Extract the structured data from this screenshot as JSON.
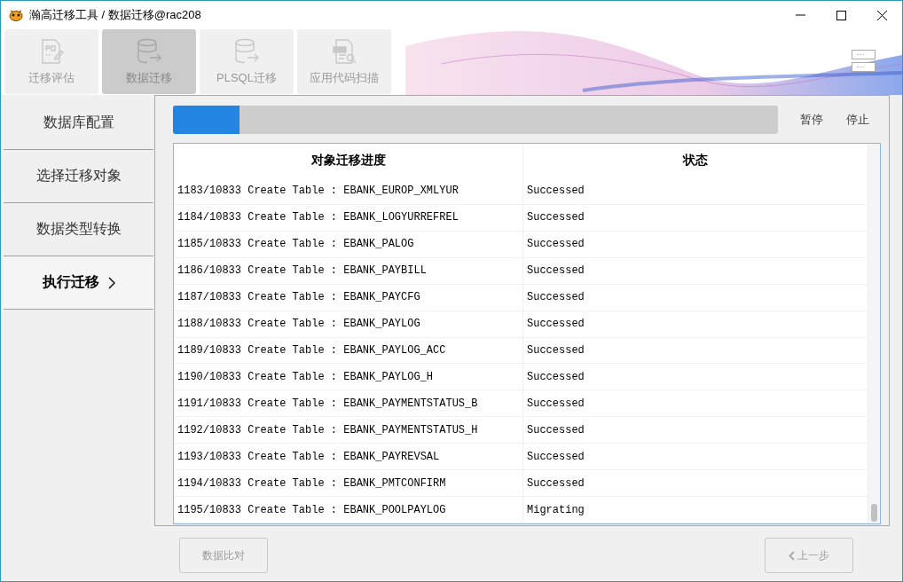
{
  "window": {
    "title": "瀚高迁移工具 / 数据迁移@rac208"
  },
  "tabs": [
    {
      "label": "迁移评估",
      "kind": "assess",
      "selected": false
    },
    {
      "label": "数据迁移",
      "kind": "data",
      "selected": true
    },
    {
      "label": "PLSQL迁移",
      "kind": "plsql",
      "selected": false
    },
    {
      "label": "应用代码扫描",
      "kind": "scan",
      "selected": false
    }
  ],
  "sidebar": {
    "items": [
      {
        "label": "数据库配置",
        "selected": false
      },
      {
        "label": "选择迁移对象",
        "selected": false
      },
      {
        "label": "数据类型转换",
        "selected": false
      },
      {
        "label": "执行迁移",
        "selected": true
      }
    ]
  },
  "progress": {
    "level": 0.11,
    "buttons": [
      "暂停",
      "停止"
    ]
  },
  "table": {
    "columns": [
      "对象迁移进度",
      "状态"
    ],
    "rows": [
      [
        "1183/10833 Create Table : EBANK_EUROP_XMLYUR",
        "Successed"
      ],
      [
        "1184/10833 Create Table : EBANK_LOGYURREFREL",
        "Successed"
      ],
      [
        "1185/10833 Create Table : EBANK_PALOG",
        "Successed"
      ],
      [
        "1186/10833 Create Table : EBANK_PAYBILL",
        "Successed"
      ],
      [
        "1187/10833 Create Table : EBANK_PAYCFG",
        "Successed"
      ],
      [
        "1188/10833 Create Table : EBANK_PAYLOG",
        "Successed"
      ],
      [
        "1189/10833 Create Table : EBANK_PAYLOG_ACC",
        "Successed"
      ],
      [
        "1190/10833 Create Table : EBANK_PAYLOG_H",
        "Successed"
      ],
      [
        "1191/10833 Create Table : EBANK_PAYMENTSTATUS_B",
        "Successed"
      ],
      [
        "1192/10833 Create Table : EBANK_PAYMENTSTATUS_H",
        "Successed"
      ],
      [
        "1193/10833 Create Table : EBANK_PAYREVSAL",
        "Successed"
      ],
      [
        "1194/10833 Create Table : EBANK_PMTCONFIRM",
        "Successed"
      ],
      [
        "1195/10833 Create Table : EBANK_POOLPAYLOG",
        "Migrating"
      ]
    ]
  },
  "footer": {
    "buttons": [
      {
        "label": "数据比对",
        "kind": "plain",
        "disabled": true
      },
      {
        "label": "上一步",
        "kind": "back",
        "disabled": true
      }
    ]
  }
}
